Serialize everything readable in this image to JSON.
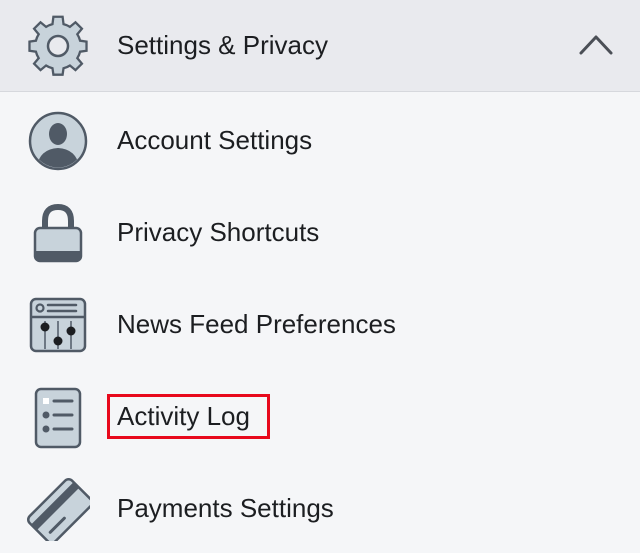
{
  "header": {
    "title": "Settings & Privacy",
    "icon": "gear-icon",
    "toggle_icon": "chevron-up-icon"
  },
  "menu": {
    "items": [
      {
        "label": "Account Settings",
        "icon": "account-icon"
      },
      {
        "label": "Privacy Shortcuts",
        "icon": "lock-icon"
      },
      {
        "label": "News Feed Preferences",
        "icon": "news-feed-preferences-icon"
      },
      {
        "label": "Activity Log",
        "icon": "activity-log-icon"
      },
      {
        "label": "Payments Settings",
        "icon": "credit-card-icon"
      }
    ]
  },
  "colors": {
    "header_bg": "#e9eaee",
    "list_bg": "#f5f6f8",
    "icon_stroke": "#505a66",
    "icon_fill": "#c8d3db",
    "highlight": "#e8091c"
  }
}
